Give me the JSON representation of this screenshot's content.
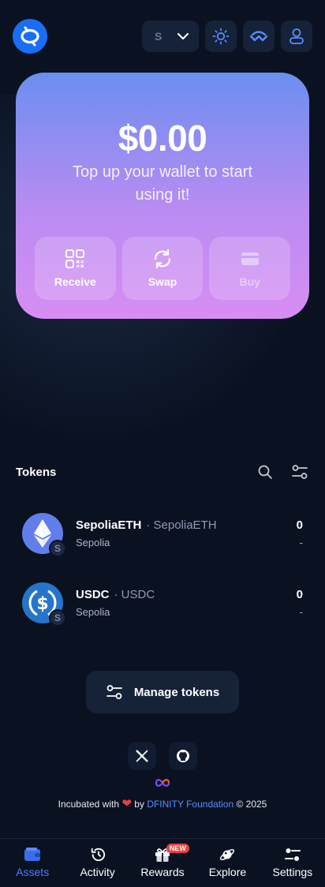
{
  "header": {
    "network_letter": "S"
  },
  "card": {
    "balance": "$0.00",
    "subtitle": "Top up your wallet to start using it!",
    "actions": [
      {
        "label": "Receive",
        "enabled": true
      },
      {
        "label": "Swap",
        "enabled": true
      },
      {
        "label": "Buy",
        "enabled": false
      }
    ]
  },
  "tokens": {
    "title": "Tokens",
    "items": [
      {
        "name": "SepoliaETH",
        "symbol": "· SepoliaETH",
        "network": "Sepolia",
        "network_badge": "S",
        "balance": "0",
        "usd": "-",
        "color": "#627eea"
      },
      {
        "name": "USDC",
        "symbol": "· USDC",
        "network": "Sepolia",
        "network_badge": "S",
        "balance": "0",
        "usd": "-",
        "color": "#2775ca"
      }
    ],
    "manage_label": "Manage tokens"
  },
  "footer": {
    "prefix": "Incubated with",
    "by": "by",
    "link": "DFINITY Foundation",
    "suffix": "© 2025"
  },
  "nav": {
    "items": [
      {
        "label": "Assets",
        "icon": "wallet-icon",
        "active": true
      },
      {
        "label": "Activity",
        "icon": "history-icon",
        "active": false
      },
      {
        "label": "Rewards",
        "icon": "gift-icon",
        "active": false,
        "badge": "NEW"
      },
      {
        "label": "Explore",
        "icon": "planet-icon",
        "active": false
      },
      {
        "label": "Settings",
        "icon": "settings-icon",
        "active": false
      }
    ]
  },
  "colors": {
    "background": "#0a1222",
    "accent": "#1a6ef5",
    "card_top": "#6b8ef0",
    "card_bottom": "#d88df3",
    "active_nav": "#4a7dff"
  }
}
